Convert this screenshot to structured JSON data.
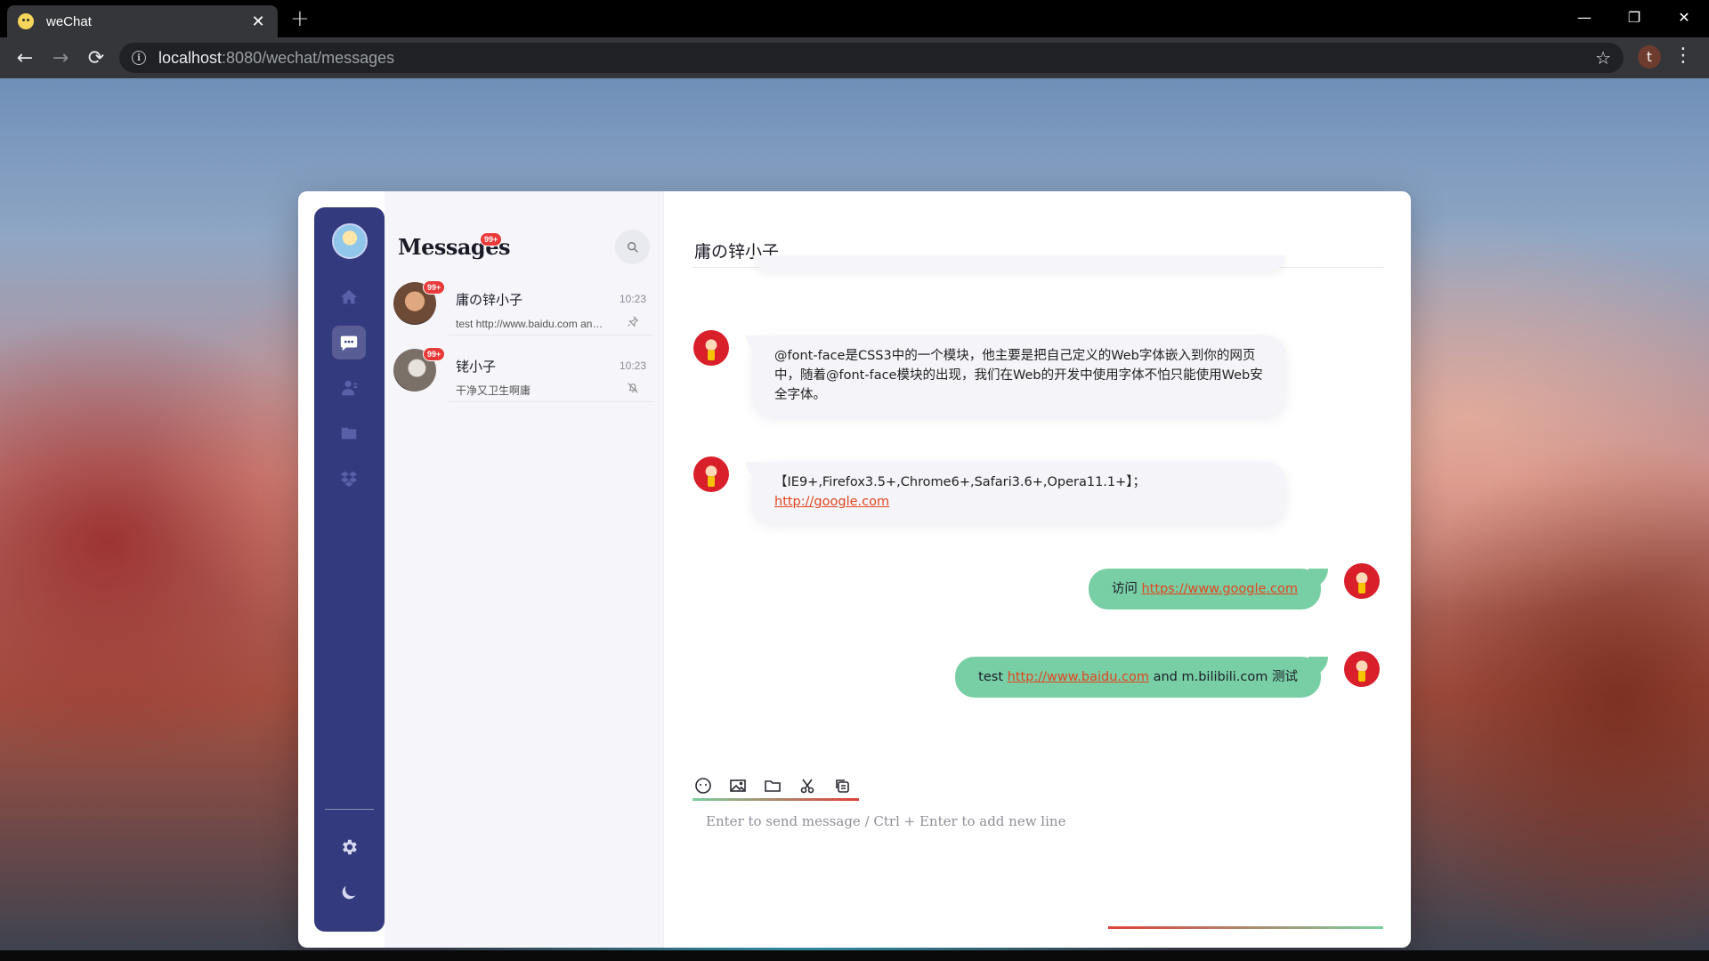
{
  "browser": {
    "tab_title": "weChat",
    "tab_close": "✕",
    "new_tab": "+",
    "url_host": "localhost",
    "url_rest": ":8080/wechat/messages",
    "profile_initial": "t",
    "window_controls": {
      "minimize": "—",
      "restore": "❐",
      "close": "✕"
    }
  },
  "sidebar": {
    "items": [
      {
        "name": "home",
        "icon": "home-icon",
        "active": false
      },
      {
        "name": "messages",
        "icon": "chat-icon",
        "active": true
      },
      {
        "name": "contacts",
        "icon": "contacts-icon",
        "active": false
      },
      {
        "name": "files",
        "icon": "folder-share-icon",
        "active": false
      },
      {
        "name": "apps",
        "icon": "dropbox-icon",
        "active": false
      }
    ],
    "bottom": [
      {
        "name": "settings",
        "icon": "gear-icon"
      },
      {
        "name": "theme",
        "icon": "moon-icon"
      }
    ]
  },
  "conversations": {
    "title": "Messages",
    "unread_badge": "99+",
    "items": [
      {
        "name": "庸の锌小子",
        "time": "10:23",
        "preview": "test http://www.baidu.com and m.bilibili.com 测试",
        "badge": "99+",
        "flag": "pin-icon"
      },
      {
        "name": "铑小子",
        "time": "10:23",
        "preview": "干净又卫生啊庸",
        "badge": "99+",
        "flag": "mute-icon"
      }
    ]
  },
  "chat": {
    "title": "庸の锌小子",
    "messages": [
      {
        "direction": "in",
        "text": "@font-face是CSS3中的一个模块，他主要是把自己定义的Web字体嵌入到你的网页中，随着@font-face模块的出现，我们在Web的开发中使用字体不怕只能使用Web安全字体。"
      },
      {
        "direction": "in",
        "text_before": "【IE9+,Firefox3.5+,Chrome6+,Safari3.6+,Opera11.1+】；",
        "link": "http://google.com"
      },
      {
        "direction": "out",
        "text_before": "访问 ",
        "link": "https://www.google.com",
        "text_after": ""
      },
      {
        "direction": "out",
        "text_before": "test ",
        "link": "http://www.baidu.com",
        "text_after": " and m.bilibili.com 测试"
      }
    ]
  },
  "composer": {
    "placeholder": "Enter to send message / Ctrl + Enter to add new line",
    "tools": [
      "emoji-icon",
      "image-icon",
      "folder-icon",
      "scissors-icon",
      "copy-icon"
    ]
  },
  "colors": {
    "rail": "#343a7e",
    "outgoing_bubble": "#78cfa5",
    "incoming_bubble": "#f4f4f9",
    "link": "#e2451e",
    "badge": "#e83a3a"
  }
}
